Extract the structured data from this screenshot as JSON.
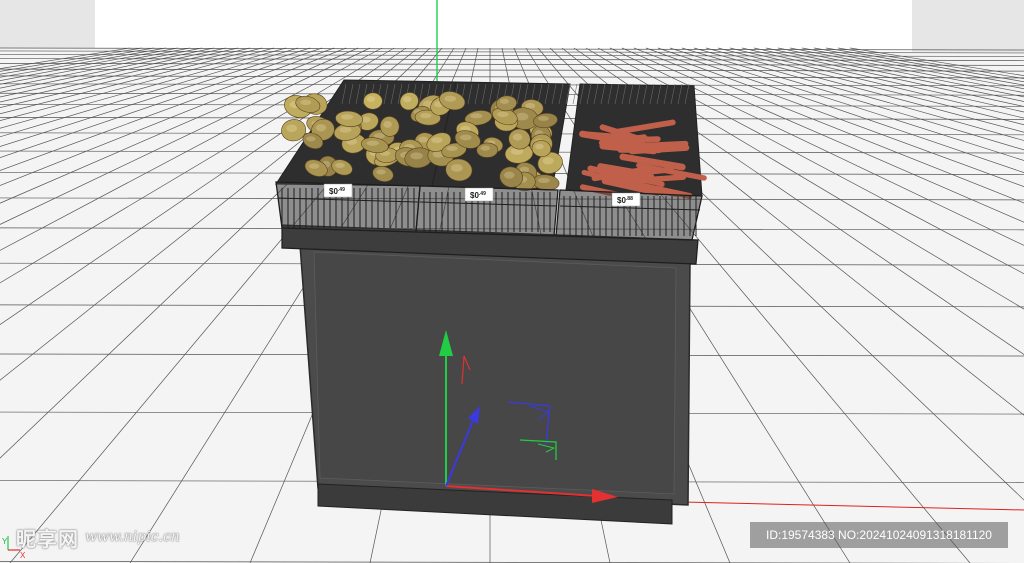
{
  "viewport": {
    "price_tags": [
      {
        "main": "$0",
        "cents": ".49"
      },
      {
        "main": "$0",
        "cents": ".49"
      },
      {
        "main": "$0",
        "cents": ".88"
      }
    ],
    "axis_indicator": {
      "y": "Y",
      "x": "X"
    },
    "colors": {
      "stand": "#4a4a4a",
      "stand_dark": "#2e2e2e",
      "basket": "#2a2a2a",
      "potato": "#a98a4c",
      "carrot": "#c0604a",
      "axis_x": "#e33030",
      "axis_y": "#22cc44",
      "axis_z": "#3a3ae0"
    }
  },
  "watermark": {
    "logo": "昵享网",
    "url": "www.nipic.cn"
  },
  "id_banner": {
    "text": "ID:19574383 NO:20241024091318181120"
  }
}
